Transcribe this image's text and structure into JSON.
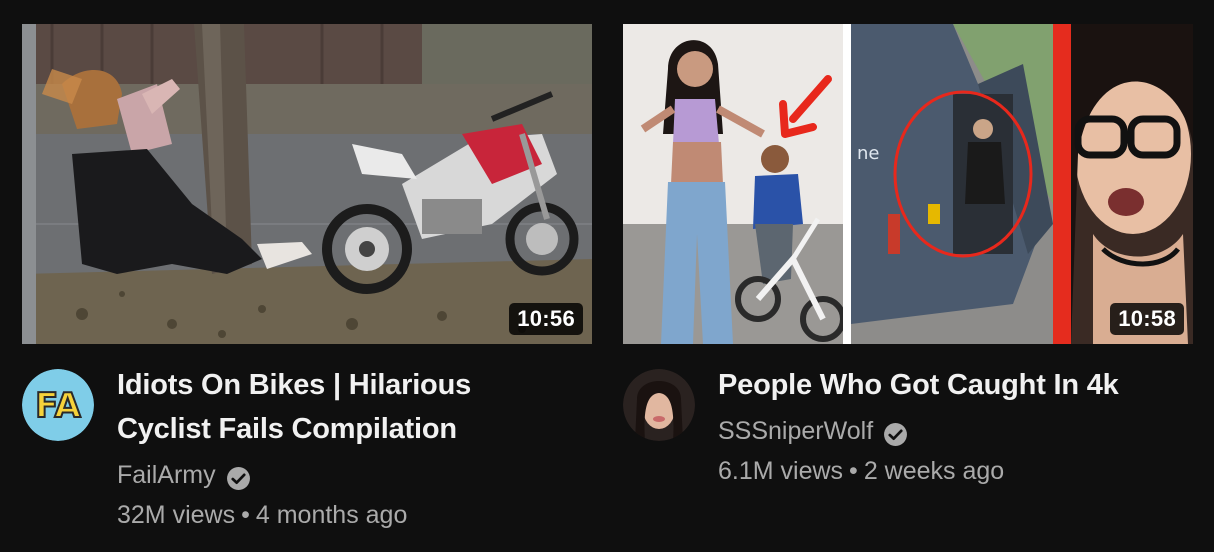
{
  "videos": [
    {
      "title_line1": "Idiots On Bikes | Hilarious",
      "title_line2": "Cyclist Fails Compilation",
      "channel": "FailArmy",
      "views": "32M views",
      "age": "4 months ago",
      "duration": "10:56",
      "avatar_text": "FA",
      "verified": true
    },
    {
      "title_line1": "People Who Got Caught In 4k",
      "title_line2": "",
      "channel": "SSSniperWolf",
      "views": "6.1M views",
      "age": "2 weeks ago",
      "duration": "10:58",
      "verified": true
    }
  ],
  "separator": "•",
  "colors": {
    "background": "#0f0f0f",
    "title": "#f1f1f1",
    "secondary_text": "#aaaaaa",
    "duration_bg": "#000000",
    "accent_red": "#e8281c"
  }
}
